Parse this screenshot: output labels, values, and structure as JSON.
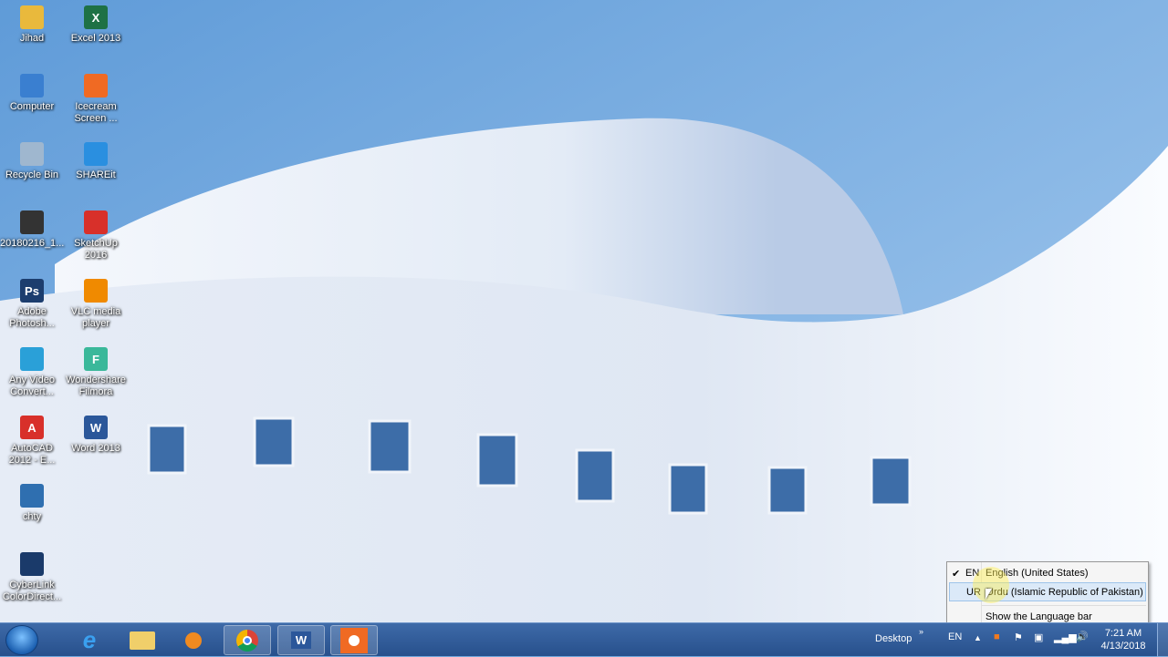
{
  "desktop": {
    "icons_col1": [
      {
        "label": "Jihad",
        "icon": "folder-icon",
        "color": "#e9b93c"
      },
      {
        "label": "Computer",
        "icon": "computer-icon",
        "color": "#3a7fd0"
      },
      {
        "label": "Recycle Bin",
        "icon": "recycle-bin-icon",
        "color": "#9fb7cf"
      },
      {
        "label": "20180216_1...",
        "icon": "photo-icon",
        "color": "#333333"
      },
      {
        "label": "Adobe Photosh...",
        "icon": "photoshop-icon",
        "color": "#1c3d6e",
        "glyph": "Ps"
      },
      {
        "label": "Any Video Convert...",
        "icon": "video-converter-icon",
        "color": "#2aa0d8"
      },
      {
        "label": "AutoCAD 2012 - E...",
        "icon": "autocad-icon",
        "color": "#d8302a",
        "glyph": "A"
      },
      {
        "label": "chty",
        "icon": "image-icon",
        "color": "#2f6fb0"
      },
      {
        "label": "CyberLink ColorDirect...",
        "icon": "cyberlink-icon",
        "color": "#1a3a6a"
      }
    ],
    "icons_col2": [
      {
        "label": "Excel 2013",
        "icon": "excel-icon",
        "color": "#1e7145",
        "glyph": "X"
      },
      {
        "label": "Icecream Screen ...",
        "icon": "icecream-icon",
        "color": "#f06a23"
      },
      {
        "label": "SHAREit",
        "icon": "shareit-icon",
        "color": "#2a8fe0"
      },
      {
        "label": "SketchUp 2016",
        "icon": "sketchup-icon",
        "color": "#d8302a"
      },
      {
        "label": "VLC media player",
        "icon": "vlc-icon",
        "color": "#f08a00"
      },
      {
        "label": "Wondershare Filmora",
        "icon": "filmora-icon",
        "color": "#3ab89a",
        "glyph": "F"
      },
      {
        "label": "Word 2013",
        "icon": "word-icon",
        "color": "#2b579a",
        "glyph": "W"
      }
    ]
  },
  "language_menu": {
    "items": [
      {
        "code": "EN",
        "label": "English (United States)",
        "checked": true
      },
      {
        "code": "UR",
        "label": "Urdu (Islamic Republic of Pakistan)",
        "checked": false
      }
    ],
    "show_bar": "Show the Language bar"
  },
  "taskbar": {
    "desktop_label": "Desktop",
    "lang": "EN",
    "time": "7:21 AM",
    "date": "4/13/2018"
  }
}
